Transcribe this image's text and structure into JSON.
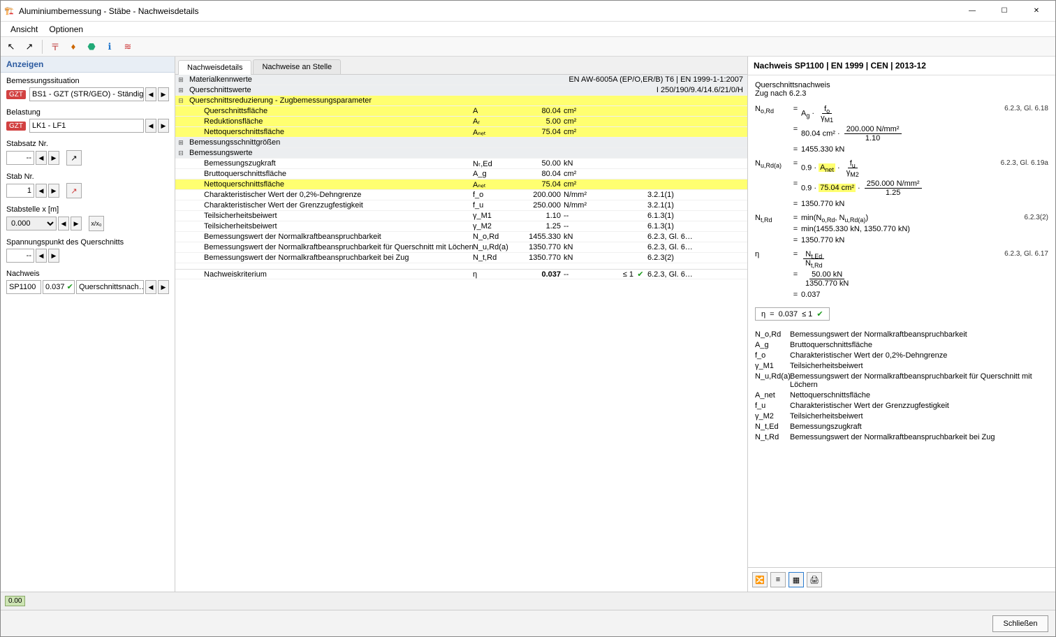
{
  "window": {
    "title": "Aluminiumbemessung - Stäbe - Nachweisdetails"
  },
  "menu": {
    "view": "Ansicht",
    "options": "Optionen"
  },
  "sidebar": {
    "header": "Anzeigen",
    "design_situation": {
      "label": "Bemessungssituation",
      "badge": "GZT",
      "value": "BS1 - GZT (STR/GEO) - Ständig …"
    },
    "loading": {
      "label": "Belastung",
      "badge": "GZT",
      "value": "LK1 - LF1"
    },
    "member_set": {
      "label": "Stabsatz Nr.",
      "value": "--"
    },
    "member": {
      "label": "Stab Nr.",
      "value": "1"
    },
    "location": {
      "label": "Stabstelle x [m]",
      "value": "0.000"
    },
    "stress_point": {
      "label": "Spannungspunkt des Querschnitts",
      "value": "--"
    },
    "check": {
      "label": "Nachweis",
      "id": "SP1100",
      "ratio": "0.037",
      "text": "Querschnittsnach…"
    }
  },
  "tabs": {
    "details": "Nachweisdetails",
    "at_loc": "Nachweise an Stelle"
  },
  "tree": {
    "material": {
      "label": "Materialkennwerte",
      "right": "EN AW-6005A (EP/O,ER/B) T6 | EN 1999-1-1:2007"
    },
    "section": {
      "label": "Querschnittswerte",
      "right": "I 250/190/9.4/14.6/21/0/H"
    },
    "reduction": {
      "label": "Querschnittsreduzierung - Zugbemessungsparameter",
      "rows": [
        {
          "label": "Querschnittsfläche",
          "sym": "A",
          "val": "80.04",
          "unit": "cm²"
        },
        {
          "label": "Reduktionsfläche",
          "sym": "Aᵣ",
          "val": "5.00",
          "unit": "cm²"
        },
        {
          "label": "Nettoquerschnittsfläche",
          "sym": "Aₙₑₜ",
          "val": "75.04",
          "unit": "cm²"
        }
      ]
    },
    "internal": {
      "label": "Bemessungsschnittgrößen"
    },
    "values": {
      "label": "Bemessungswerte",
      "rows": [
        {
          "label": "Bemessungszugkraft",
          "sym": "Nₜ,Ed",
          "val": "50.00",
          "unit": "kN",
          "ref": ""
        },
        {
          "label": "Bruttoquerschnittsfläche",
          "sym": "A_g",
          "val": "80.04",
          "unit": "cm²",
          "ref": ""
        },
        {
          "label": "Nettoquerschnittsfläche",
          "sym": "Aₙₑₜ",
          "val": "75.04",
          "unit": "cm²",
          "ref": "",
          "hl": true
        },
        {
          "label": "Charakteristischer Wert der 0,2%-Dehngrenze",
          "sym": "f_o",
          "val": "200.000",
          "unit": "N/mm²",
          "ref": "3.2.1(1)"
        },
        {
          "label": "Charakteristischer Wert der Grenzzugfestigkeit",
          "sym": "f_u",
          "val": "250.000",
          "unit": "N/mm²",
          "ref": "3.2.1(1)"
        },
        {
          "label": "Teilsicherheitsbeiwert",
          "sym": "γ_M1",
          "val": "1.10",
          "unit": "--",
          "ref": "6.1.3(1)"
        },
        {
          "label": "Teilsicherheitsbeiwert",
          "sym": "γ_M2",
          "val": "1.25",
          "unit": "--",
          "ref": "6.1.3(1)"
        },
        {
          "label": "Bemessungswert der Normalkraftbeanspruchbarkeit",
          "sym": "N_o,Rd",
          "val": "1455.330",
          "unit": "kN",
          "ref": "6.2.3, Gl. 6…"
        },
        {
          "label": "Bemessungswert der Normalkraftbeanspruchbarkeit für Querschnitt mit Löchern",
          "sym": "N_u,Rd(a)",
          "val": "1350.770",
          "unit": "kN",
          "ref": "6.2.3, Gl. 6…"
        },
        {
          "label": "Bemessungswert der Normalkraftbeanspruchbarkeit bei Zug",
          "sym": "N_t,Rd",
          "val": "1350.770",
          "unit": "kN",
          "ref": "6.2.3(2)"
        }
      ]
    },
    "criterion": {
      "label": "Nachweiskriterium",
      "sym": "η",
      "val": "0.037",
      "unit": "--",
      "lim": "≤ 1",
      "ref": "6.2.3, Gl. 6…"
    }
  },
  "right": {
    "title": "Nachweis SP1100 | EN 1999 | CEN | 2013-12",
    "sub1": "Querschnittsnachweis",
    "sub2": "Zug nach 6.2.3",
    "eq1": {
      "sym": "N_o,Rd",
      "ref": "6.2.3, Gl. 6.18",
      "l2": "80.04 cm² · ",
      "l2n": "200.000 N/mm²",
      "l2d": "1.10",
      "l3": "1455.330 kN"
    },
    "eq2": {
      "sym": "N_u,Rd(a)",
      "ref": "6.2.3, Gl. 6.19a",
      "pre": "0.9 · ",
      "anet": "Aₙₑₓ",
      "l2": "0.9 · ",
      "l2a": "75.04 cm²",
      "l2n": "250.000 N/mm²",
      "l2d": "1.25",
      "l3": "1350.770 kN"
    },
    "eq3": {
      "sym": "N_t,Rd",
      "ref": "6.2.3(2)",
      "l1": "min(N_o,Rd, N_u,Rd(a))",
      "l2": "min(1455.330 kN, 1350.770 kN)",
      "l3": "1350.770 kN"
    },
    "eq4": {
      "sym": "η",
      "ref": "6.2.3, Gl. 6.17",
      "l2n": "50.00 kN",
      "l2d": "1350.770 kN",
      "l3": "0.037"
    },
    "result": {
      "sym": "η",
      "val": "0.037",
      "lim": "≤ 1"
    },
    "legend": [
      {
        "s": "N_o,Rd",
        "d": "Bemessungswert der Normalkraftbeanspruchbarkeit"
      },
      {
        "s": "A_g",
        "d": "Bruttoquerschnittsfläche"
      },
      {
        "s": "f_o",
        "d": "Charakteristischer Wert der 0,2%-Dehngrenze"
      },
      {
        "s": "γ_M1",
        "d": "Teilsicherheitsbeiwert"
      },
      {
        "s": "N_u,Rd(a)",
        "d": "Bemessungswert der Normalkraftbeanspruchbarkeit für Querschnitt mit Löchern"
      },
      {
        "s": "A_net",
        "d": "Nettoquerschnittsfläche"
      },
      {
        "s": "f_u",
        "d": "Charakteristischer Wert der Grenzzugfestigkeit"
      },
      {
        "s": "γ_M2",
        "d": "Teilsicherheitsbeiwert"
      },
      {
        "s": "N_t,Ed",
        "d": "Bemessungszugkraft"
      },
      {
        "s": "N_t,Rd",
        "d": "Bemessungswert der Normalkraftbeanspruchbarkeit bei Zug"
      }
    ]
  },
  "status": {
    "precision": "0.00"
  },
  "footer": {
    "close": "Schließen"
  }
}
